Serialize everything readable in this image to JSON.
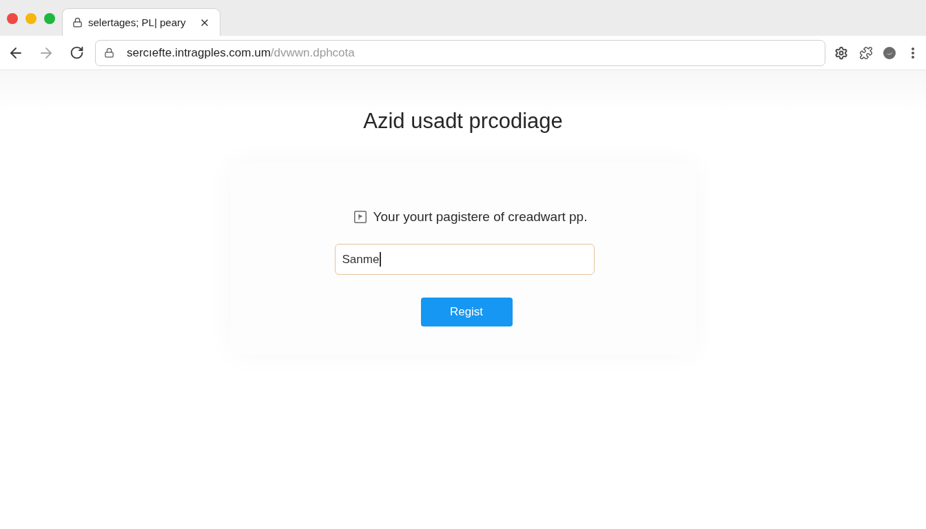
{
  "window": {
    "controls": [
      {
        "color": "#ee4a45"
      },
      {
        "color": "#f4b70f"
      },
      {
        "color": "#1eb73f"
      }
    ]
  },
  "tabs": [
    {
      "title": "selertages; PL| peary",
      "selected": true
    }
  ],
  "toolbar": {
    "back_disabled": false,
    "forward_disabled": true,
    "address": {
      "host": "sercıefte.intragples.com.um",
      "path": "/dvwwn.dphcota"
    }
  },
  "page": {
    "heading": "Azid usadt prcodiage",
    "prompt": "Your yourt pagistere of creadwart pp.",
    "name_field": {
      "value": "Sanme",
      "focused": true
    },
    "submit_button": "Regist"
  }
}
